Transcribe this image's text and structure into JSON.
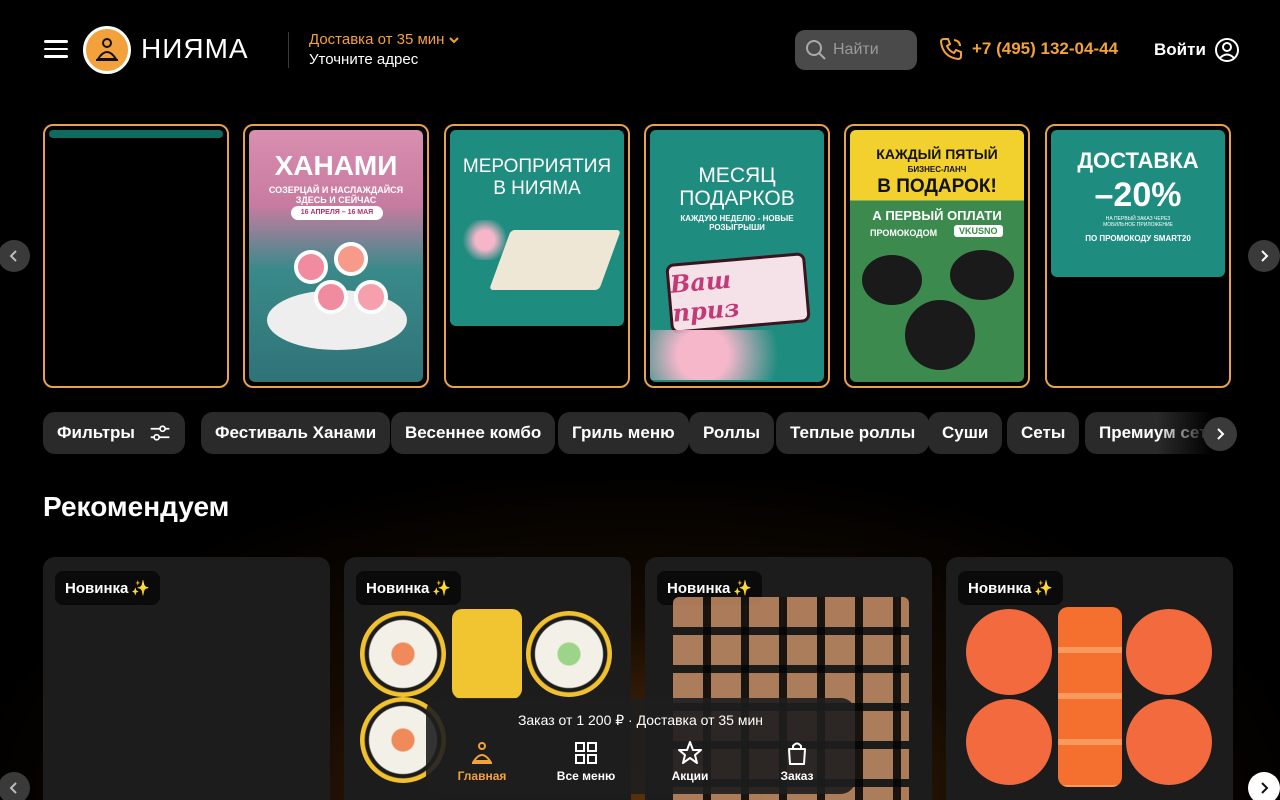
{
  "header": {
    "logo_text": "НИЯМА",
    "delivery_label": "Доставка от 35 мин",
    "address_label": "Уточните адрес",
    "search_placeholder": "Найти",
    "phone": "+7 (495) 132-04-44",
    "login_label": "Войти"
  },
  "stories": [
    {
      "title": "",
      "subtitle": ""
    },
    {
      "title": "ХАНАМИ",
      "subtitle": "СОЗЕРЦАЙ И НАСЛАЖДАЙСЯ ЗДЕСЬ И СЕЙЧАС",
      "date": "16 АПРЕЛЯ – 16 МАЯ"
    },
    {
      "title": "МЕРОПРИЯТИЯ В НИЯМА",
      "subtitle": ""
    },
    {
      "title": "МЕСЯЦ ПОДАРКОВ",
      "subtitle": "КАЖДУЮ НЕДЕЛЮ - НОВЫЕ РОЗЫГРЫШИ",
      "prize": "Ваш приз"
    },
    {
      "title": "КАЖДЫЙ ПЯТЫЙ",
      "subtitle": "БИЗНЕС-ЛАНЧ",
      "title2": "В ПОДАРОК!",
      "line": "А ПЕРВЫЙ ОПЛАТИ",
      "promo_label": "ПРОМОКОДОМ",
      "promo": "VKUSNO"
    },
    {
      "title": "ДОСТАВКА",
      "discount": "–20%",
      "note": "НА ПЕРВЫЙ ЗАКАЗ ЧЕРЕЗ МОБИЛЬНОЕ ПРИЛОЖЕНИЕ",
      "promo": "ПО ПРОМОКОДУ SMART20"
    }
  ],
  "filters_label": "Фильтры",
  "categories": [
    "Фестиваль Ханами",
    "Весеннее комбо",
    "Гриль меню",
    "Роллы",
    "Теплые роллы",
    "Суши",
    "Сеты",
    "Премиум сеты"
  ],
  "section_title": "Рекомендуем",
  "products": [
    {
      "badge": "Новинка"
    },
    {
      "badge": "Новинка"
    },
    {
      "badge": "Новинка"
    },
    {
      "badge": "Новинка"
    }
  ],
  "bottom_bar": {
    "note": "Заказ от 1 200 ₽ · Доставка от 35 мин",
    "items": [
      "Главная",
      "Все меню",
      "Акции",
      "Заказ"
    ]
  },
  "colors": {
    "accent": "#f3a23b",
    "chip_bg": "#2a2a2a",
    "story_border": "#e8a24c"
  }
}
